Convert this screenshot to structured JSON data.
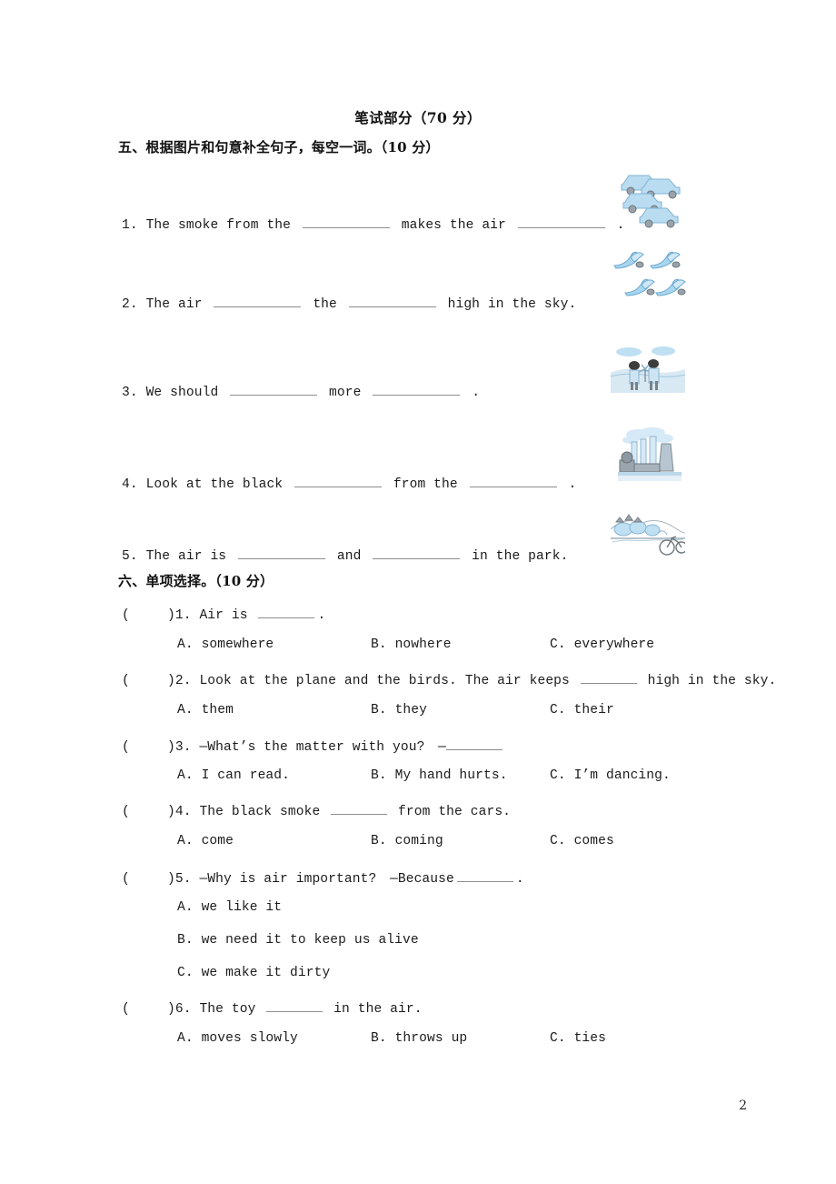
{
  "document": {
    "section_title": "笔试部分（70 分）",
    "page_number": "2"
  },
  "part_five": {
    "heading": "五、根据图片和句意补全句子，每空一词。（10 分）",
    "items": [
      {
        "number": "1.",
        "before": "The smoke from the",
        "middle": "makes the air",
        "after": ".",
        "picture": "traffic-jam-cars-picture"
      },
      {
        "number": "2.",
        "before": "The air",
        "middle": "the",
        "after": "high in the sky.",
        "picture": "flying-birds-picture"
      },
      {
        "number": "3.",
        "before": "We should",
        "middle": "more",
        "after": ".",
        "picture": "children-planting-trees-picture"
      },
      {
        "number": "4.",
        "before": "Look at the black",
        "middle": "from the",
        "after": ".",
        "picture": "factory-smokestacks-picture"
      },
      {
        "number": "5.",
        "before": "The air is",
        "middle": "and",
        "after": "in the park.",
        "picture": "park-with-bicycle-picture"
      }
    ]
  },
  "part_six": {
    "heading": "六、单项选择。（10 分）",
    "questions": [
      {
        "number": ")1.",
        "stem_before": "Air is",
        "stem_after": ".",
        "options": [
          "A. somewhere",
          "B. nowhere",
          "C. everywhere"
        ],
        "layout": "row"
      },
      {
        "number": ")2.",
        "stem_before": "Look at the plane and the birds. The air keeps",
        "stem_after": "high in the sky.",
        "options": [
          "A. them",
          "B. they",
          "C. their"
        ],
        "layout": "row"
      },
      {
        "number": ")3.",
        "stem_before": "—What’s the matter with you?　—",
        "stem_after": "",
        "options": [
          "A. I can read.",
          "B. My hand hurts.",
          "C. I’m dancing."
        ],
        "layout": "row"
      },
      {
        "number": ")4.",
        "stem_before": "The black smoke",
        "stem_after": "from the cars.",
        "options": [
          "A. come",
          "B. coming",
          "C. comes"
        ],
        "layout": "row"
      },
      {
        "number": ")5.",
        "stem_before": "—Why is air important?　—Because",
        "stem_after": ".",
        "options": [
          "A. we like it",
          "B. we need it to keep us alive",
          "C. we make it dirty"
        ],
        "layout": "stacked"
      },
      {
        "number": ")6.",
        "stem_before": "The toy",
        "stem_after": "in the air.",
        "options": [
          "A. moves slowly",
          "B. throws up",
          "C. ties"
        ],
        "layout": "row"
      }
    ],
    "open_paren": "("
  },
  "colors": {
    "text": "#1a1a1a",
    "blank_rule": "#8d8d8d",
    "art_blue": "#8fc4e8",
    "art_blue_light": "#cfe6f5",
    "art_gray": "#8a8f96",
    "art_dark": "#5f666d"
  }
}
